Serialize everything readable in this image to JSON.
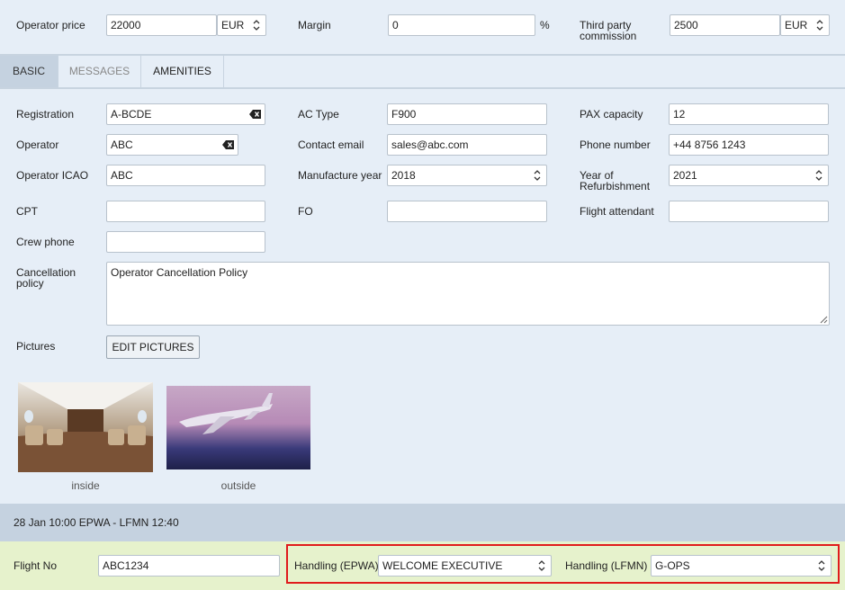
{
  "pricing": {
    "operator_price_label": "Operator price",
    "operator_price_value": "22000",
    "operator_price_currency": "EUR",
    "margin_label": "Margin",
    "margin_value": "0",
    "margin_unit": "%",
    "third_party_label_line1": "Third party",
    "third_party_label_line2": "commission",
    "third_party_value": "2500",
    "third_party_currency": "EUR"
  },
  "tabs": [
    {
      "label": "BASIC",
      "active": true
    },
    {
      "label": "MESSAGES",
      "active": false
    },
    {
      "label": "AMENITIES",
      "active": false
    }
  ],
  "basic": {
    "registration_label": "Registration",
    "registration_value": "A-BCDE",
    "ac_type_label": "AC Type",
    "ac_type_value": "F900",
    "pax_label": "PAX capacity",
    "pax_value": "12",
    "operator_label": "Operator",
    "operator_value": "ABC",
    "contact_email_label": "Contact email",
    "contact_email_value": "sales@abc.com",
    "phone_label": "Phone number",
    "phone_value": "+44 8756 1243",
    "operator_icao_label": "Operator ICAO",
    "operator_icao_value": "ABC",
    "manufacture_year_label": "Manufacture year",
    "manufacture_year_value": "2018",
    "refurb_label_line1": "Year of",
    "refurb_label_line2": "Refurbishment",
    "refurb_value": "2021",
    "cpt_label": "CPT",
    "cpt_value": "",
    "fo_label": "FO",
    "fo_value": "",
    "flight_attendant_label": "Flight attendant",
    "flight_attendant_value": "",
    "crew_phone_label": "Crew phone",
    "crew_phone_value": "",
    "cancellation_label_line1": "Cancellation",
    "cancellation_label_line2": "policy",
    "cancellation_value": "Operator Cancellation Policy",
    "pictures_label": "Pictures",
    "edit_pictures_label": "EDIT PICTURES",
    "pictures": [
      {
        "caption": "inside"
      },
      {
        "caption": "outside"
      }
    ]
  },
  "leg": {
    "header": "28 Jan 10:00 EPWA - LFMN 12:40",
    "flight_no_label": "Flight No",
    "flight_no_value": "ABC1234",
    "handling_dep_label": "Handling (EPWA)",
    "handling_dep_value": "WELCOME EXECUTIVE",
    "handling_arr_label": "Handling (LFMN)",
    "handling_arr_value": "G-OPS"
  },
  "colors": {
    "highlight": "#e01b1b",
    "panel_bg": "#e6eef7",
    "flight_row_bg": "#e6f2cc"
  }
}
